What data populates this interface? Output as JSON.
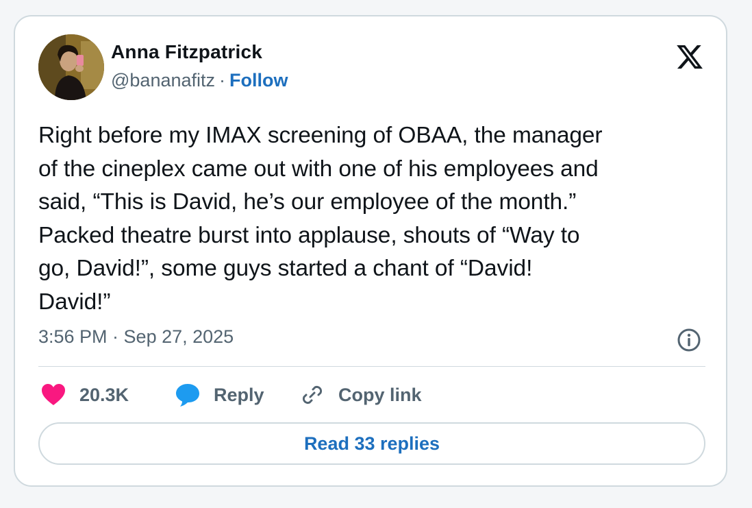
{
  "author": {
    "name": "Anna Fitzpatrick",
    "handle": "@bananafitz",
    "separator": "·",
    "follow_label": "Follow"
  },
  "tweet": {
    "text": "Right before my IMAX screening of OBAA, the manager\nof the cineplex came out with one of his employees and\nsaid, “This is David, he’s our employee of the month.”\nPacked theatre burst into applause, shouts of “Way to\ngo, David!”, some guys started a chant of “David!\nDavid!”",
    "timestamp": "3:56 PM · Sep 27, 2025"
  },
  "actions": {
    "likes": "20.3K",
    "reply_label": "Reply",
    "copy_link_label": "Copy link",
    "read_replies_label": "Read 33 replies"
  },
  "icons": {
    "brand": "x-logo-icon",
    "info": "info-icon",
    "like": "heart-icon",
    "reply": "speech-bubble-icon",
    "copy": "link-icon"
  },
  "colors": {
    "text": "#0f1419",
    "secondary": "#536471",
    "link": "#1d6fbe",
    "heart": "#f91880",
    "bubble": "#1d9bf0",
    "border": "#cfd9de"
  }
}
